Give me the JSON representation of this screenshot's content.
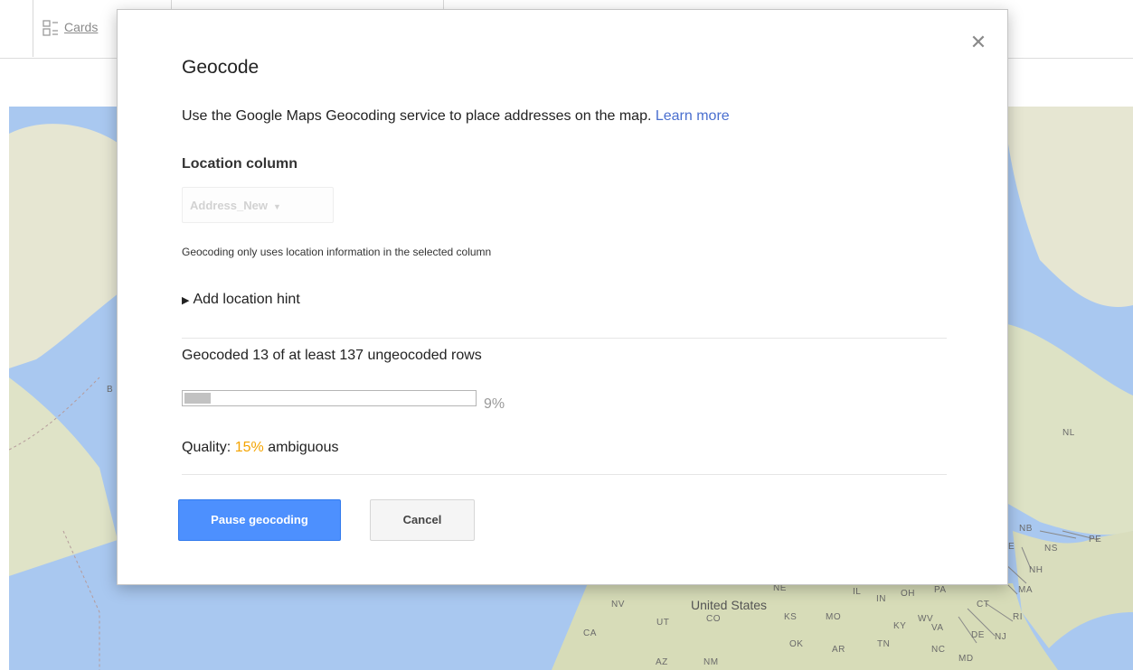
{
  "background": {
    "tab_cards_label": "Cards",
    "map_labels": {
      "b_left": "B",
      "nl": "NL",
      "nb": "NB",
      "pe": "PE",
      "ns": "NS",
      "nh": "NH",
      "ma": "MA",
      "ct": "CT",
      "ri": "RI",
      "nj": "NJ",
      "de": "DE",
      "md": "MD",
      "nc": "NC",
      "va": "VA",
      "wv": "WV",
      "ky": "KY",
      "tn": "TN",
      "oh": "OH",
      "in": "IN",
      "il": "IL",
      "pa": "PA",
      "mo": "MO",
      "ks": "KS",
      "ne": "NE",
      "co": "CO",
      "ut": "UT",
      "nv": "NV",
      "ca": "CA",
      "az": "AZ",
      "nm": "NM",
      "ok": "OK",
      "ar": "AR",
      "e": "E",
      "country": "United States"
    }
  },
  "dialog": {
    "close_glyph": "✕",
    "title": "Geocode",
    "description": "Use the Google Maps Geocoding service to place addresses on the map.",
    "learn_more": "Learn more",
    "location_column_label": "Location column",
    "location_column_value": "Address_New",
    "location_help": "Geocoding only uses location information in the selected column",
    "add_hint_label": "Add location hint",
    "status_text": "Geocoded 13 of at least 137 ungeocoded rows",
    "progress_fraction": 0.09,
    "progress_percent_text": "9%",
    "quality_prefix": "Quality:",
    "quality_percent": "15%",
    "quality_suffix": "ambiguous",
    "pause_button": "Pause geocoding",
    "cancel_button": "Cancel"
  },
  "colors": {
    "accent": "#4d90fe",
    "link": "#4a6fcf",
    "quality_warning": "#f4a400",
    "map_water": "#a9c8f0",
    "map_land": "#e9ead6"
  },
  "icons": {
    "cards": "cards-icon",
    "close": "close-icon",
    "dropdown": "chevron-down-icon",
    "disclosure": "triangle-right-icon"
  }
}
